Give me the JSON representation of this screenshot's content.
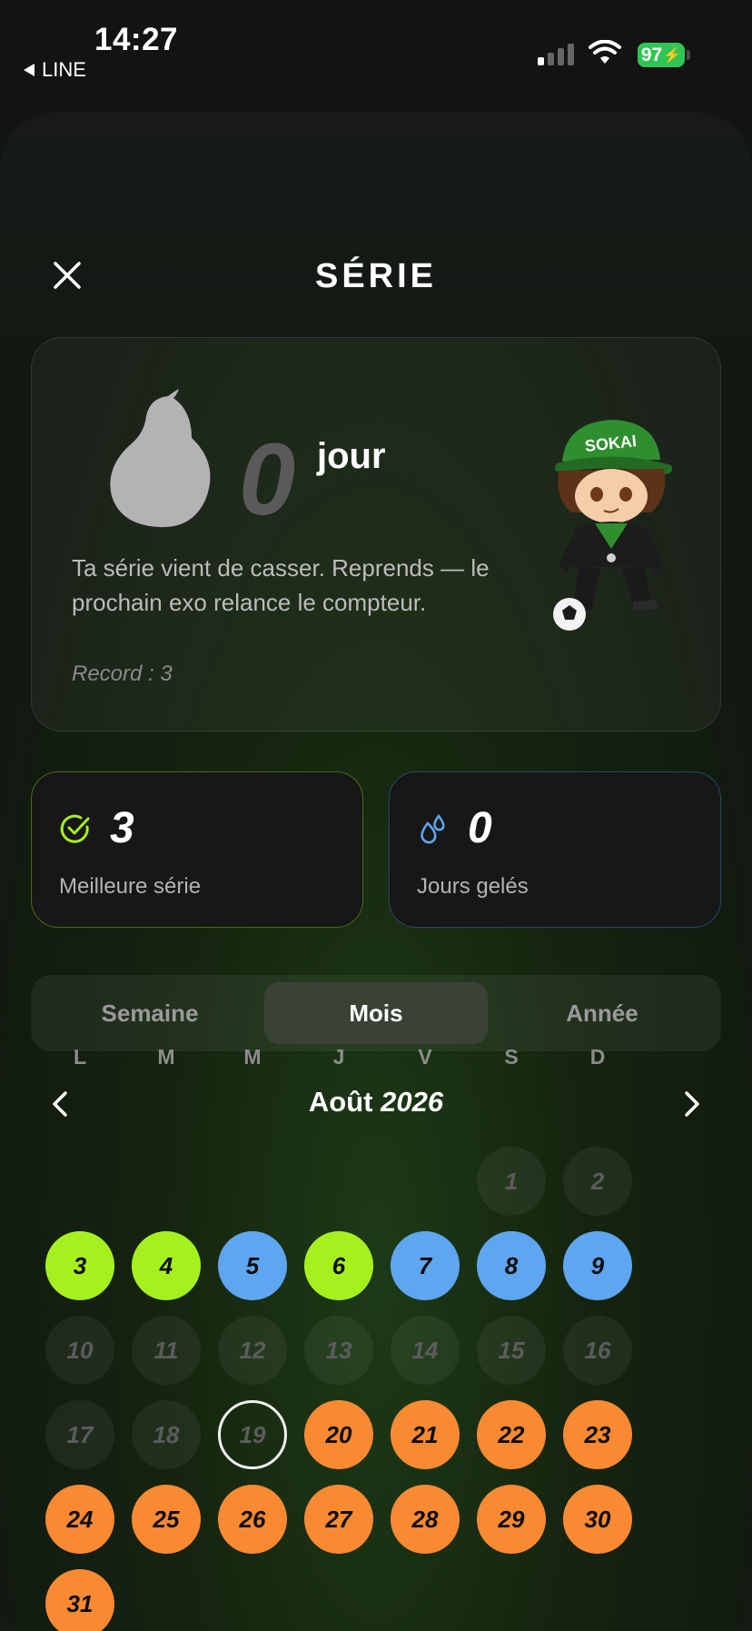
{
  "status_bar": {
    "time": "14:27",
    "back_app": "LINE",
    "battery": "97"
  },
  "header": {
    "title": "SÉRIE"
  },
  "streak": {
    "count": "0",
    "unit": "jour",
    "message": "Ta série vient de casser. Reprends — le prochain exo relance le compteur.",
    "record": "Record : 3"
  },
  "stats": {
    "best": {
      "value": "3",
      "label": "Meilleure série"
    },
    "frozen": {
      "value": "0",
      "label": "Jours gelés"
    }
  },
  "tabs": [
    {
      "label": "Semaine"
    },
    {
      "label": "Mois",
      "active": true
    },
    {
      "label": "Année"
    }
  ],
  "calendar": {
    "month": "Août",
    "year": "2026",
    "weekdays": [
      "L",
      "M",
      "M",
      "J",
      "V",
      "S",
      "D"
    ],
    "colors": {
      "done": "#a6f01e",
      "frozen": "#5ea6f0",
      "future": "#fa8a32",
      "missed": "#2a2c2a"
    },
    "days": [
      {
        "n": "1",
        "status": "empty"
      },
      {
        "n": "2",
        "status": "empty"
      },
      {
        "n": "3",
        "status": "green"
      },
      {
        "n": "4",
        "status": "green"
      },
      {
        "n": "5",
        "status": "blue"
      },
      {
        "n": "6",
        "status": "green"
      },
      {
        "n": "7",
        "status": "blue"
      },
      {
        "n": "8",
        "status": "blue"
      },
      {
        "n": "9",
        "status": "blue"
      },
      {
        "n": "10",
        "status": "empty"
      },
      {
        "n": "11",
        "status": "empty"
      },
      {
        "n": "12",
        "status": "empty"
      },
      {
        "n": "13",
        "status": "empty"
      },
      {
        "n": "14",
        "status": "empty"
      },
      {
        "n": "15",
        "status": "empty"
      },
      {
        "n": "16",
        "status": "empty"
      },
      {
        "n": "17",
        "status": "empty"
      },
      {
        "n": "18",
        "status": "empty"
      },
      {
        "n": "19",
        "status": "today"
      },
      {
        "n": "20",
        "status": "orange"
      },
      {
        "n": "21",
        "status": "orange"
      },
      {
        "n": "22",
        "status": "orange"
      },
      {
        "n": "23",
        "status": "orange"
      },
      {
        "n": "24",
        "status": "orange"
      },
      {
        "n": "25",
        "status": "orange"
      },
      {
        "n": "26",
        "status": "orange"
      },
      {
        "n": "27",
        "status": "orange"
      },
      {
        "n": "28",
        "status": "orange"
      },
      {
        "n": "29",
        "status": "orange"
      },
      {
        "n": "30",
        "status": "orange"
      },
      {
        "n": "31",
        "status": "orange"
      }
    ]
  }
}
